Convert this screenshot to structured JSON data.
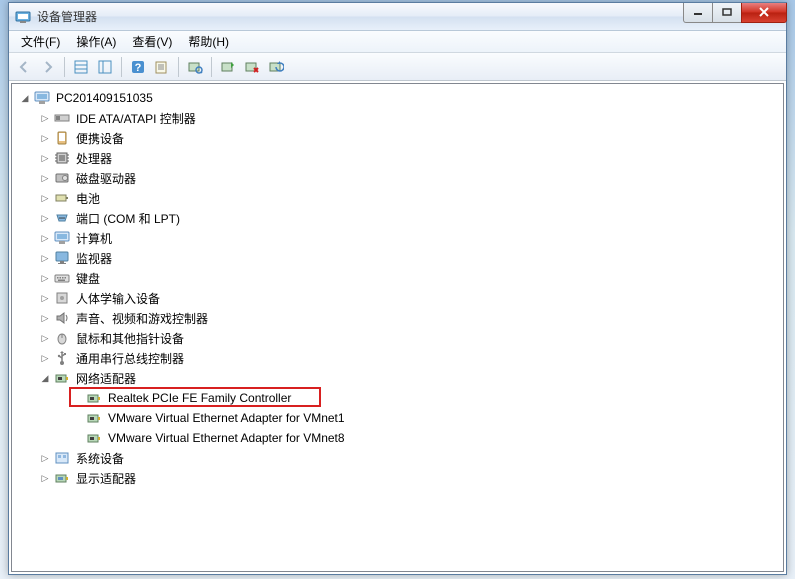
{
  "window": {
    "title": "设备管理器"
  },
  "menu": {
    "file": "文件(F)",
    "action": "操作(A)",
    "view": "查看(V)",
    "help": "帮助(H)"
  },
  "tree": {
    "root": "PC201409151035",
    "cat_ide": "IDE ATA/ATAPI 控制器",
    "cat_portable": "便携设备",
    "cat_cpu": "处理器",
    "cat_disk": "磁盘驱动器",
    "cat_battery": "电池",
    "cat_ports": "端口 (COM 和 LPT)",
    "cat_computer": "计算机",
    "cat_monitor": "监视器",
    "cat_keyboard": "键盘",
    "cat_hid": "人体学输入设备",
    "cat_sound": "声音、视频和游戏控制器",
    "cat_mouse": "鼠标和其他指针设备",
    "cat_usb": "通用串行总线控制器",
    "cat_network": "网络适配器",
    "net_realtek": "Realtek PCIe FE Family Controller",
    "net_vm1": "VMware Virtual Ethernet Adapter for VMnet1",
    "net_vm8": "VMware Virtual Ethernet Adapter for VMnet8",
    "cat_system": "系统设备",
    "cat_display": "显示适配器"
  }
}
